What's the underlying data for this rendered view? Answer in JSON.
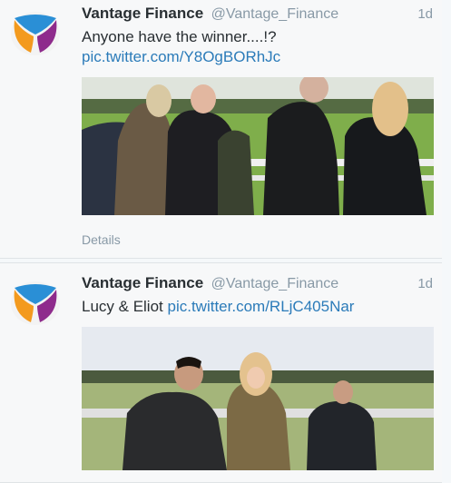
{
  "tweets": [
    {
      "author_name": "Vantage Finance",
      "handle": "@Vantage_Finance",
      "time": "1d",
      "text": "Anyone have the winner....!?",
      "link": "pic.twitter.com/Y8OgBORhJc",
      "details_label": "Details",
      "photo_icon": "racecourse-photo"
    },
    {
      "author_name": "Vantage Finance",
      "handle": "@Vantage_Finance",
      "time": "1d",
      "text": "Lucy & Eliot",
      "link": "pic.twitter.com/RLjC405Nar",
      "photo_icon": "selfie-photo"
    }
  ],
  "colors": {
    "name": "#292f33",
    "meta": "#8899a6",
    "link": "#2b7bb9",
    "logo_blue": "#2a8fd6",
    "logo_orange": "#f39a1e",
    "logo_purple": "#8e2b8c"
  }
}
